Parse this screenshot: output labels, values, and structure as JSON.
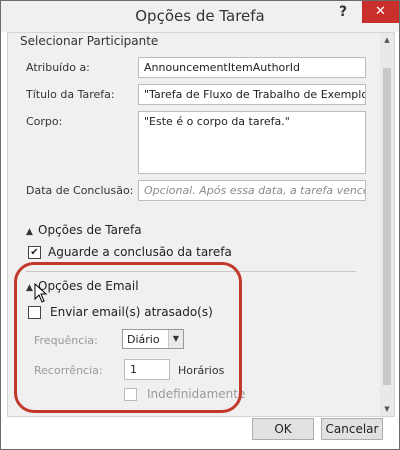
{
  "window": {
    "title": "Opções de Tarefa",
    "help_label": "?",
    "close_label": "✕"
  },
  "partial_section": "Selecionar Participante",
  "fields": {
    "assigned_label": "Atribuído a:",
    "assigned_value": "AnnouncementItemAuthorId",
    "title_label": "Título da Tarefa:",
    "title_value": "\"Tarefa de Fluxo de Trabalho de Exemplo\"",
    "body_label": "Corpo:",
    "body_value": "\"Este é o corpo da tarefa.\"",
    "due_label": "Data de Conclusão:",
    "due_placeholder": "Opcional. Após essa data, a tarefa vence"
  },
  "task_options": {
    "header": "Opções de Tarefa",
    "wait_label": "Aguarde a conclusão da tarefa",
    "wait_checked": true
  },
  "email_options": {
    "header": "Opções de Email",
    "send_overdue_label": "Enviar email(s) atrasado(s)",
    "send_overdue_checked": false,
    "frequency_label": "Frequência:",
    "frequency_value": "Diário",
    "recurrence_label": "Recorrência:",
    "recurrence_value": "1",
    "recurrence_unit": "Horários",
    "indefinitely_label": "Indefinidamente"
  },
  "buttons": {
    "ok": "OK",
    "cancel": "Cancelar"
  },
  "icons": {
    "help": "help-icon",
    "close": "close-icon",
    "check": "checkmark-icon",
    "chevron_up": "chevron-up-icon",
    "dropdown": "chevron-down-icon"
  },
  "colors": {
    "close_button": "#c9302c",
    "highlight": "#c0392b"
  }
}
